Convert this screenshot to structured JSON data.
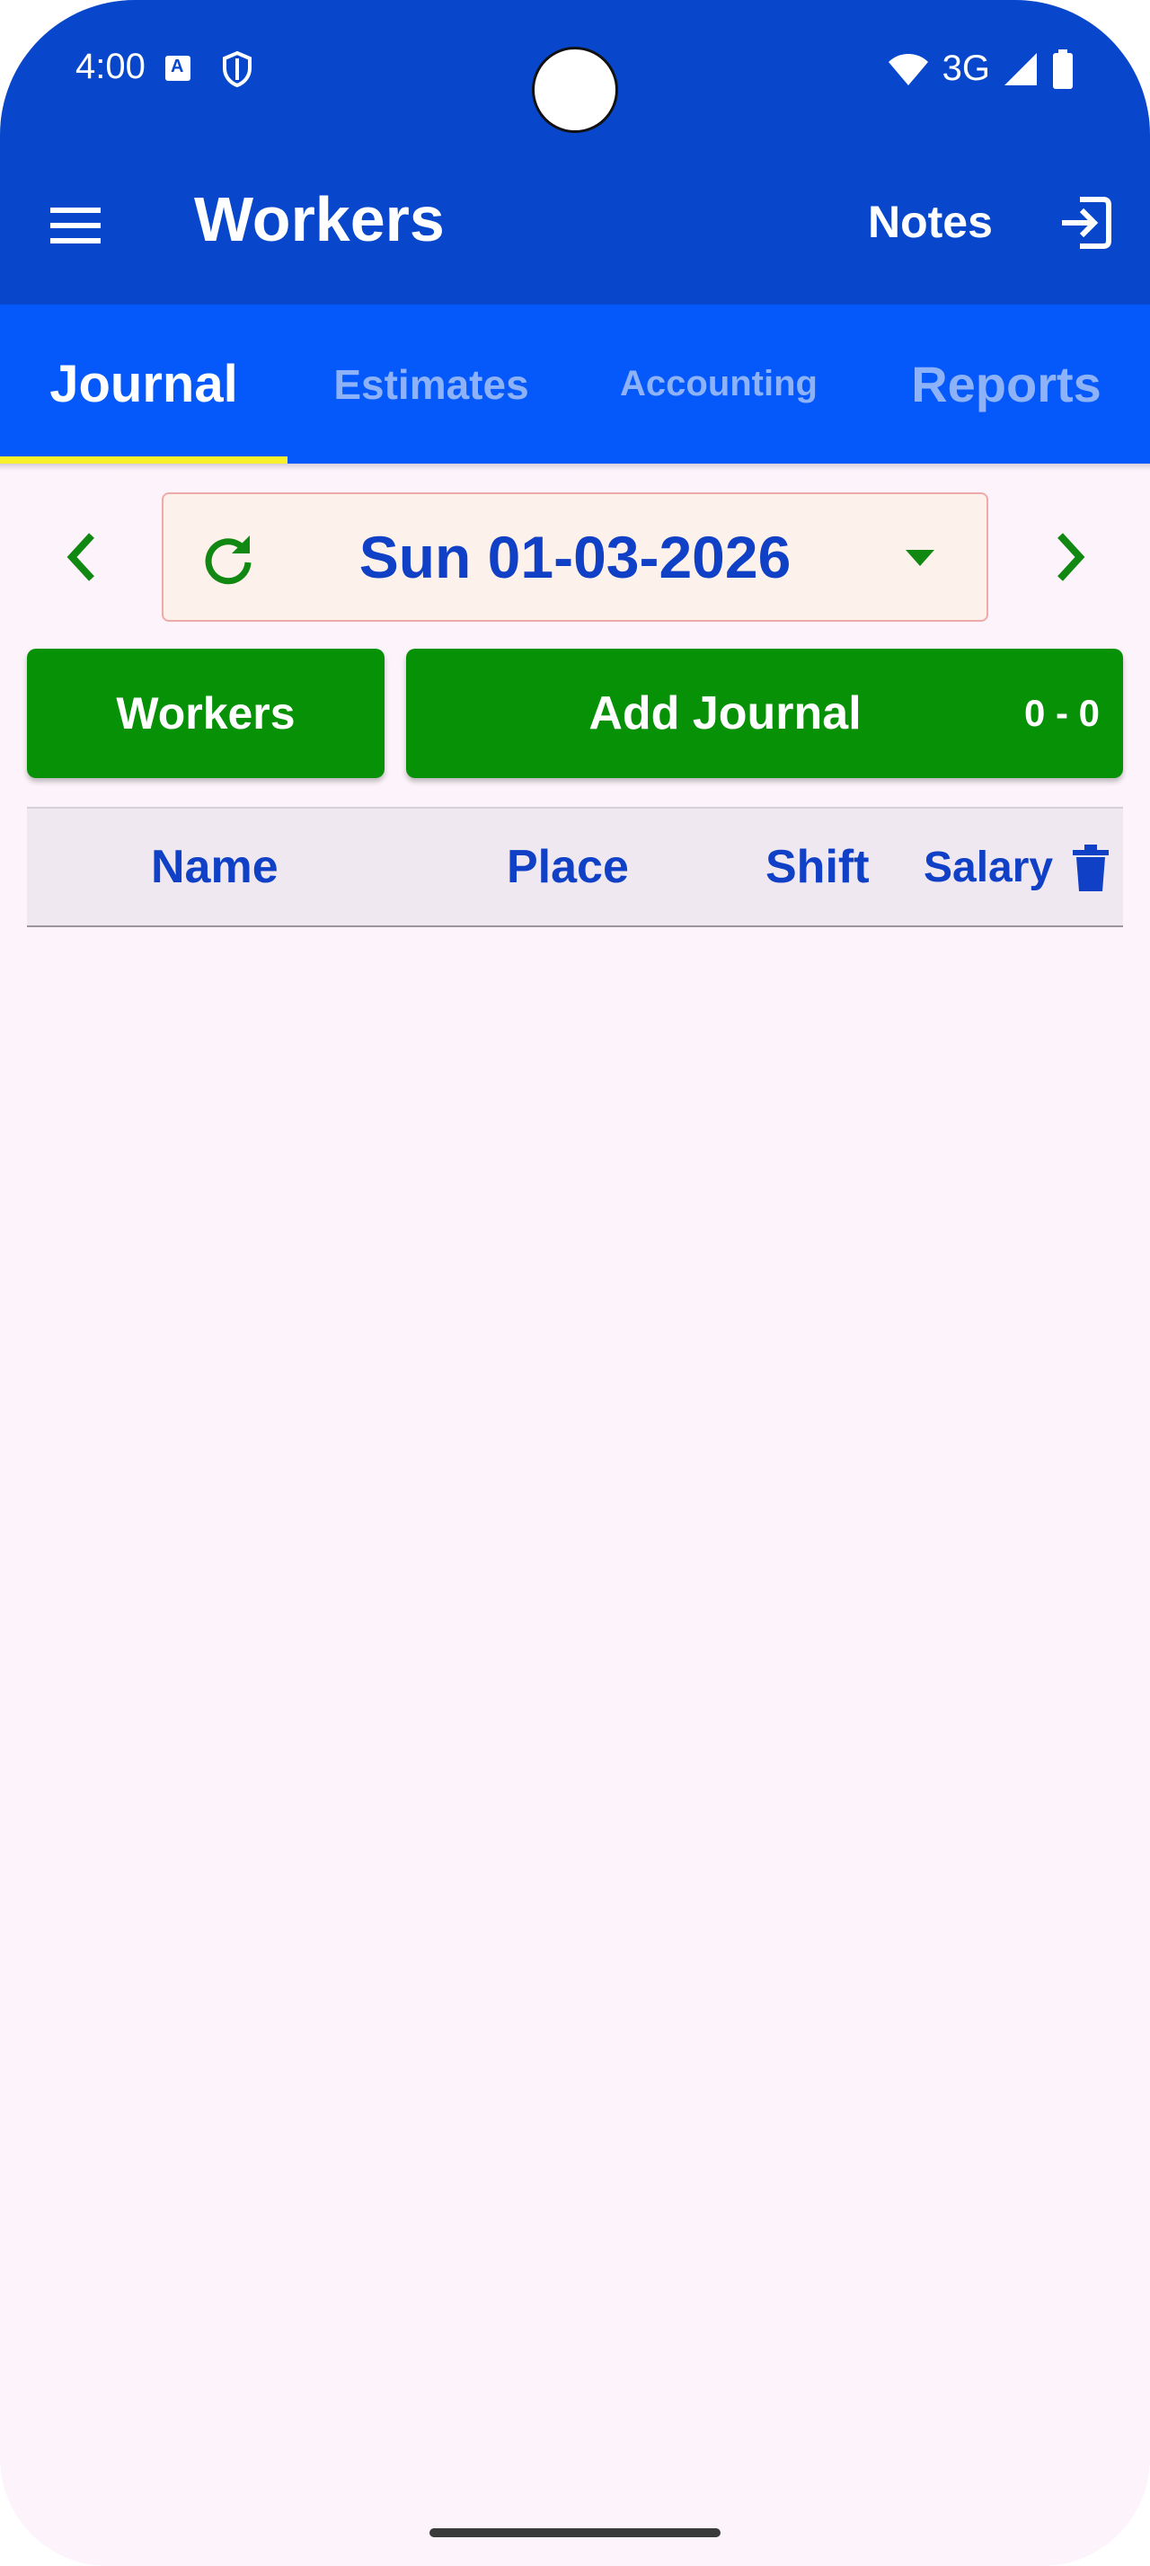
{
  "status_bar": {
    "time": "4:00",
    "network": "3G"
  },
  "app_bar": {
    "title": "Workers",
    "notes_label": "Notes"
  },
  "tabs": [
    {
      "label": "Journal",
      "active": true
    },
    {
      "label": "Estimates",
      "active": false
    },
    {
      "label": "Accounting",
      "active": false
    },
    {
      "label": "Reports",
      "active": false
    }
  ],
  "date_picker": {
    "date": "Sun 01-03-2026"
  },
  "actions": {
    "workers_label": "Workers",
    "add_journal_label": "Add Journal",
    "count": "0 - 0"
  },
  "table": {
    "columns": [
      "Name",
      "Place",
      "Shift",
      "Salary"
    ],
    "rows": []
  },
  "colors": {
    "app_bar": "#0847cc",
    "tab_bar": "#0559fa",
    "tab_indicator": "#f7f02a",
    "button_green": "#069106",
    "accent_text": "#1040c6",
    "background": "#fcf4fa"
  },
  "icons": [
    "menu-icon",
    "logout-icon",
    "chevron-left-icon",
    "refresh-icon",
    "dropdown-icon",
    "chevron-right-icon",
    "trash-icon"
  ]
}
